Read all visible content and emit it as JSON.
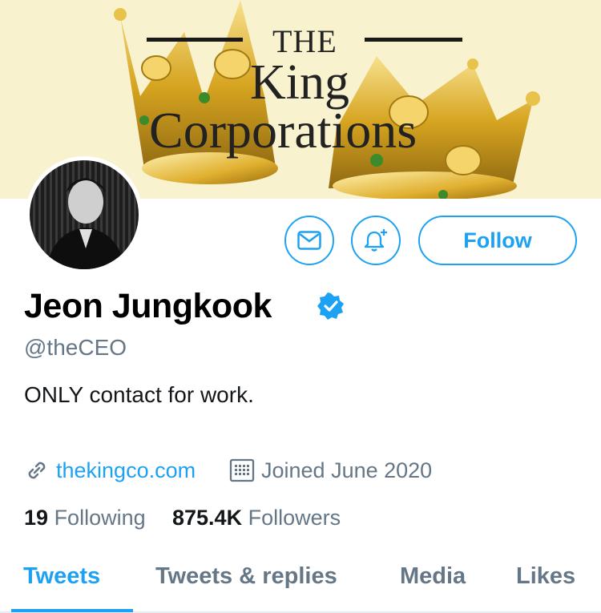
{
  "banner": {
    "line1": "THE",
    "line2": "King",
    "line3": "Corporations"
  },
  "profile": {
    "name": "Jeon Jungkook",
    "handle": "@theCEO",
    "bio": "ONLY contact for work.",
    "website": "thekingco.com",
    "joined": "Joined June 2020",
    "following_count": "19",
    "following_label": "Following",
    "followers_count": "875.4K",
    "followers_label": "Followers"
  },
  "actions": {
    "follow_label": "Follow",
    "message_icon": "envelope-icon",
    "notify_icon": "bell-plus-icon"
  },
  "tabs": [
    {
      "label": "Tweets",
      "active": true
    },
    {
      "label": "Tweets & replies",
      "active": false
    },
    {
      "label": "Media",
      "active": false
    },
    {
      "label": "Likes",
      "active": false
    }
  ],
  "colors": {
    "accent": "#1da1f2",
    "secondary_text": "#657786",
    "banner_bg": "#f9f2cf"
  }
}
